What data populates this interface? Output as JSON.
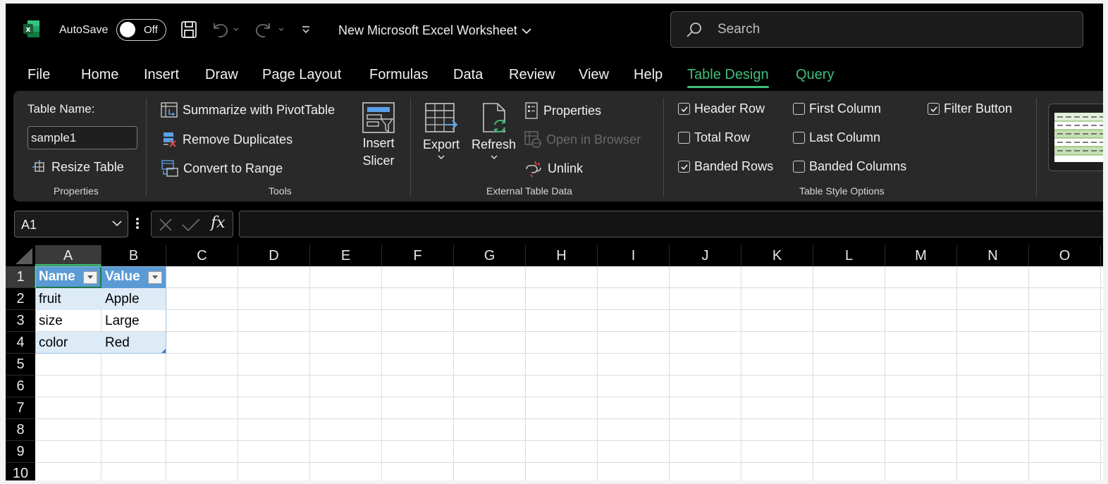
{
  "app": {
    "autosave_label": "AutoSave",
    "autosave_state": "Off",
    "document_title": "New Microsoft Excel Worksheet",
    "search_placeholder": "Search"
  },
  "menu_tabs": [
    {
      "label": "File"
    },
    {
      "label": "Home"
    },
    {
      "label": "Insert"
    },
    {
      "label": "Draw"
    },
    {
      "label": "Page Layout"
    },
    {
      "label": "Formulas"
    },
    {
      "label": "Data"
    },
    {
      "label": "Review"
    },
    {
      "label": "View"
    },
    {
      "label": "Help"
    },
    {
      "label": "Table Design",
      "active": true
    },
    {
      "label": "Query"
    }
  ],
  "ribbon": {
    "properties": {
      "table_name_label": "Table Name:",
      "table_name_value": "sample1",
      "resize_table": "Resize Table",
      "group_label": "Properties"
    },
    "tools": {
      "summarize_pivot": "Summarize with PivotTable",
      "remove_duplicates": "Remove Duplicates",
      "convert_to_range": "Convert to Range",
      "insert_slicer_line1": "Insert",
      "insert_slicer_line2": "Slicer",
      "group_label": "Tools"
    },
    "external": {
      "export": "Export",
      "refresh": "Refresh",
      "properties": "Properties",
      "open_in_browser": "Open in Browser",
      "unlink": "Unlink",
      "group_label": "External Table Data"
    },
    "style_options": {
      "header_row": {
        "label": "Header Row",
        "checked": true
      },
      "total_row": {
        "label": "Total Row",
        "checked": false
      },
      "banded_rows": {
        "label": "Banded Rows",
        "checked": true
      },
      "first_column": {
        "label": "First Column",
        "checked": false
      },
      "last_column": {
        "label": "Last Column",
        "checked": false
      },
      "banded_columns": {
        "label": "Banded Columns",
        "checked": false
      },
      "filter_button": {
        "label": "Filter Button",
        "checked": true
      },
      "group_label": "Table Style Options"
    }
  },
  "formula_bar": {
    "name_box": "A1",
    "fx_label": "fx",
    "formula": ""
  },
  "grid": {
    "columns": [
      "A",
      "B",
      "C",
      "D",
      "E",
      "F",
      "G",
      "H",
      "I",
      "J",
      "K",
      "L",
      "M",
      "N",
      "O"
    ],
    "rows": [
      "1",
      "2",
      "3",
      "4",
      "5",
      "6",
      "7",
      "8",
      "9",
      "10"
    ],
    "selected_column": "A",
    "selected_row": "1",
    "table": {
      "headers": [
        "Name",
        "Value"
      ],
      "rows": [
        [
          "fruit",
          "Apple"
        ],
        [
          "size",
          "Large"
        ],
        [
          "color",
          "Red"
        ]
      ]
    }
  },
  "colors": {
    "accent_green": "#3fbf7a",
    "table_header_blue": "#5b9bd5",
    "table_band_blue": "#ddebf7",
    "excel_green": "#1d6f42"
  }
}
